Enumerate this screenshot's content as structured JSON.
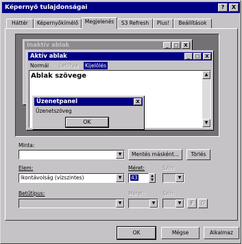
{
  "window": {
    "title": "Képernyő tulajdonságai",
    "help_label": "?",
    "close_label": "X"
  },
  "tabs": [
    {
      "label": "Háttér",
      "active": false
    },
    {
      "label": "Képernyőkímélő",
      "active": false
    },
    {
      "label": "Megjelenés",
      "active": true
    },
    {
      "label": "S3 Refresh",
      "active": false
    },
    {
      "label": "Plus!",
      "active": false
    },
    {
      "label": "Beállítások",
      "active": false
    }
  ],
  "preview": {
    "inactive_title": "Inaktív ablak",
    "active_title": "Aktív ablak",
    "menu_normal": "Normál",
    "menu_disabled": "Letiltva",
    "menu_selected": "Kijelölés",
    "window_text": "Ablak szövege",
    "message_title": "Üzenetpanel",
    "message_text": "Üzenetszöveg",
    "ok_label": "OK",
    "min_label": "_",
    "max_label": "□",
    "close_label": "X"
  },
  "scheme": {
    "label": "Minta:",
    "value": "",
    "save_as_label": "Mentés másként...",
    "delete_label": "Törlés"
  },
  "item": {
    "label": "Elem:",
    "value": "Ikontávolság (vízszintes)",
    "size_label": "Méret:",
    "size_value": "43",
    "color_label": "Szín:"
  },
  "font": {
    "label": "Betűtípus:",
    "value": "",
    "size_label": "Méret:",
    "color_label": "Szín:",
    "bold_label": "F",
    "italic_label": "D"
  },
  "footer": {
    "ok_label": "OK",
    "cancel_label": "Mégse",
    "apply_label": "Alkalmaz"
  },
  "icons": {
    "dropdown": "chevron-down-icon",
    "scroll_up": "arrow-up-icon",
    "scroll_down": "arrow-down-icon"
  }
}
